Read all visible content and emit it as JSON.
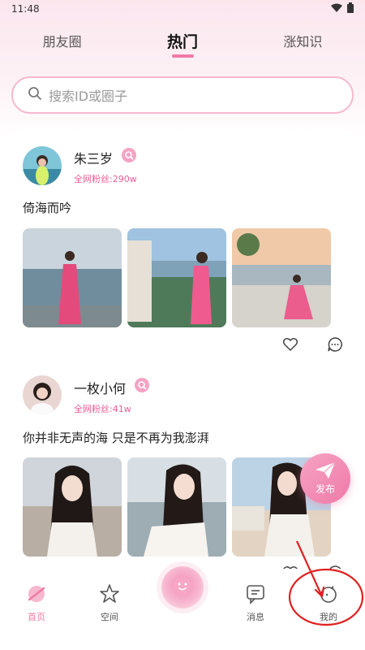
{
  "status_bar": {
    "time": "11:48"
  },
  "tabs": [
    {
      "label": "朋友圈"
    },
    {
      "label": "热门"
    },
    {
      "label": "涨知识"
    }
  ],
  "search": {
    "placeholder": "搜索ID或圈子"
  },
  "posts": [
    {
      "username": "朱三岁",
      "fans": "全网粉丝:290w",
      "text": "倚海而吟"
    },
    {
      "username": "一枚小何",
      "fans": "全网粉丝:41w",
      "text": "你并非无声的海 只是不再为我澎湃"
    }
  ],
  "publish": {
    "label": "发布"
  },
  "tabbar": [
    {
      "label": "首页",
      "icon": "home-icon"
    },
    {
      "label": "空间",
      "icon": "star-icon"
    },
    {
      "label": "消息",
      "icon": "message-icon"
    },
    {
      "label": "我的",
      "icon": "profile-icon"
    }
  ],
  "colors": {
    "accent": "#f07aa5",
    "fans": "#ec5c95",
    "annotation": "#e02020"
  }
}
